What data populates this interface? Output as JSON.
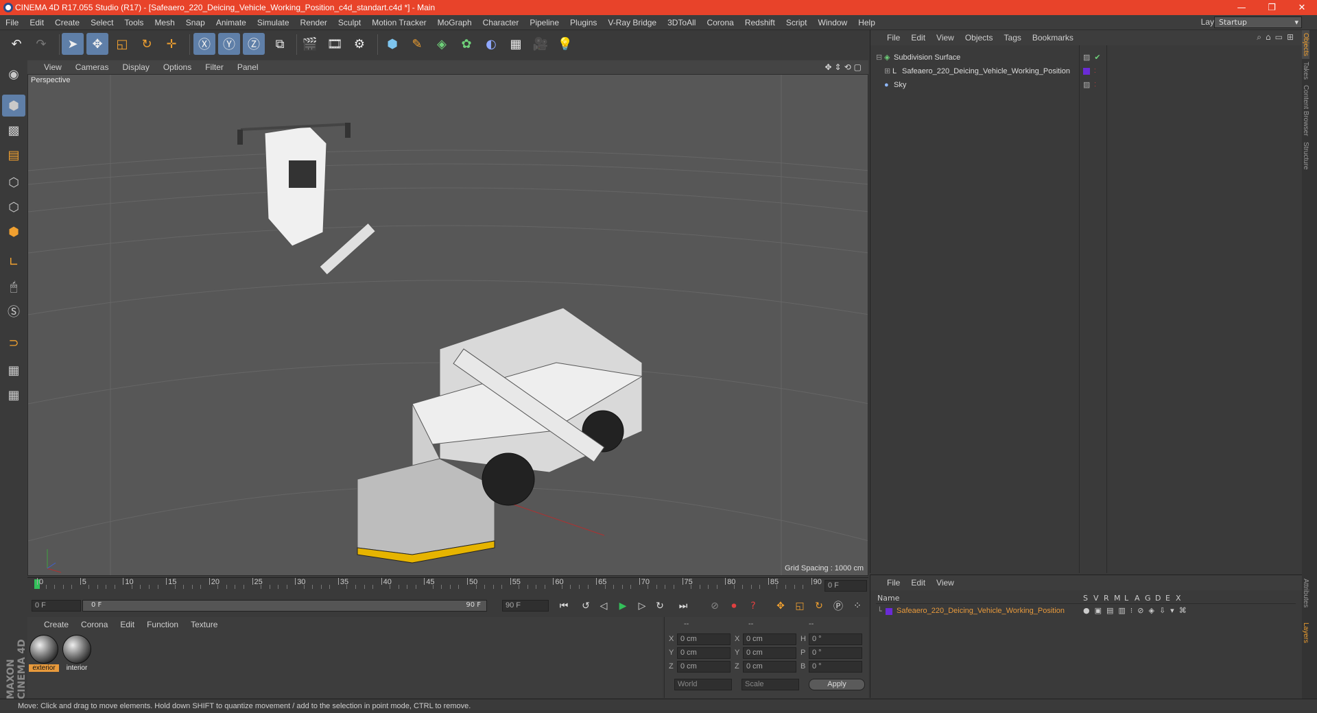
{
  "window": {
    "title": "CINEMA 4D R17.055 Studio (R17) - [Safeaero_220_Deicing_Vehicle_Working_Position_c4d_standart.c4d *] - Main",
    "minimize": "—",
    "restore": "❐",
    "close": "✕"
  },
  "menubar": [
    "File",
    "Edit",
    "Create",
    "Select",
    "Tools",
    "Mesh",
    "Snap",
    "Animate",
    "Simulate",
    "Render",
    "Sculpt",
    "Motion Tracker",
    "MoGraph",
    "Character",
    "Pipeline",
    "Plugins",
    "V-Ray Bridge",
    "3DToAll",
    "Corona",
    "Redshift",
    "Script",
    "Window",
    "Help"
  ],
  "layout": {
    "label": "Layout:",
    "value": "Startup"
  },
  "viewport": {
    "menu": [
      "View",
      "Cameras",
      "Display",
      "Options",
      "Filter",
      "Panel"
    ],
    "label": "Perspective",
    "grid_spacing": "Grid Spacing : 1000 cm"
  },
  "timeline": {
    "ticks": [
      "0",
      "5",
      "10",
      "15",
      "20",
      "25",
      "30",
      "35",
      "40",
      "45",
      "50",
      "55",
      "60",
      "65",
      "70",
      "75",
      "80",
      "85",
      "90"
    ],
    "current_frame": "0 F",
    "start": "0 F",
    "range_start": "0 F",
    "range_end": "90 F",
    "end": "90 F"
  },
  "materials": {
    "menu": [
      "Create",
      "Corona",
      "Edit",
      "Function",
      "Texture"
    ],
    "items": [
      {
        "name": "exterior"
      },
      {
        "name": "interior"
      }
    ]
  },
  "coords": {
    "headers": [
      "--",
      "--",
      "--"
    ],
    "rows": [
      {
        "a": "X",
        "av": "0 cm",
        "b": "X",
        "bv": "0 cm",
        "c": "H",
        "cv": "0 °"
      },
      {
        "a": "Y",
        "av": "0 cm",
        "b": "Y",
        "bv": "0 cm",
        "c": "P",
        "cv": "0 °"
      },
      {
        "a": "Z",
        "av": "0 cm",
        "b": "Z",
        "bv": "0 cm",
        "c": "B",
        "cv": "0 °"
      }
    ],
    "space": "World",
    "mode": "Scale",
    "apply": "Apply"
  },
  "objects": {
    "menu": [
      "File",
      "Edit",
      "View",
      "Objects",
      "Tags",
      "Bookmarks"
    ],
    "items": [
      {
        "name": "Subdivision Surface"
      },
      {
        "name": "Safeaero_220_Deicing_Vehicle_Working_Position"
      },
      {
        "name": "Sky"
      }
    ]
  },
  "layers": {
    "menu": [
      "File",
      "Edit",
      "View"
    ],
    "name_header": "Name",
    "columns": [
      "S",
      "V",
      "R",
      "M",
      "L",
      "A",
      "G",
      "D",
      "E",
      "X"
    ],
    "row": "Safeaero_220_Deicing_Vehicle_Working_Position"
  },
  "side_tabs": [
    "Objects",
    "Takes",
    "Content Browser",
    "Structure"
  ],
  "side_tabs_bottom": [
    "Attributes",
    "Layers"
  ],
  "logo": "MAXON CINEMA 4D",
  "status": "Move: Click and drag to move elements. Hold down SHIFT to quantize movement / add to the selection in point mode, CTRL to remove.",
  "colors": {
    "titlebar": "#e8432a",
    "accent": "#5f7fa8",
    "layer_name": "#e89a3c"
  }
}
